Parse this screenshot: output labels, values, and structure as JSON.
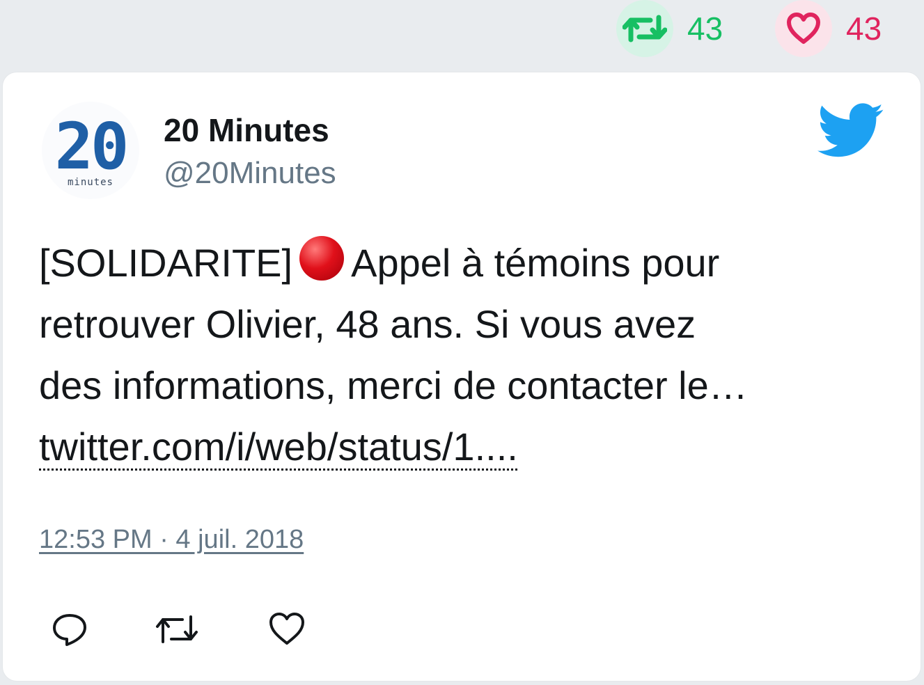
{
  "stats": {
    "retweet_count": "43",
    "like_count": "43",
    "retweet_icon": "retweet-icon",
    "like_icon": "heart-icon"
  },
  "tweet": {
    "author_name": "20 Minutes",
    "author_handle": "@20Minutes",
    "avatar": {
      "mark": "20",
      "sub": "minutes"
    },
    "text_line1_before": "[SOLIDARITE]",
    "text_line1_emoji": "red-circle-emoji",
    "text_line1_after": "Appel à témoins pour",
    "text_line2": "retrouver Olivier, 48 ans. Si vous avez",
    "text_line3": "des informations, merci de contacter le…",
    "link_text": "twitter.com/i/web/status/1....",
    "timestamp": "12:53 PM · 4 juil. 2018"
  },
  "actions": {
    "reply_icon": "reply-icon",
    "retweet_icon": "retweet-icon",
    "like_icon": "heart-icon"
  },
  "colors": {
    "background": "#e9ecef",
    "retweet_green": "#17bf63",
    "like_red": "#e0245e",
    "twitter_blue": "#1da1f2",
    "text_dark": "#14171a",
    "text_gray": "#657786"
  }
}
